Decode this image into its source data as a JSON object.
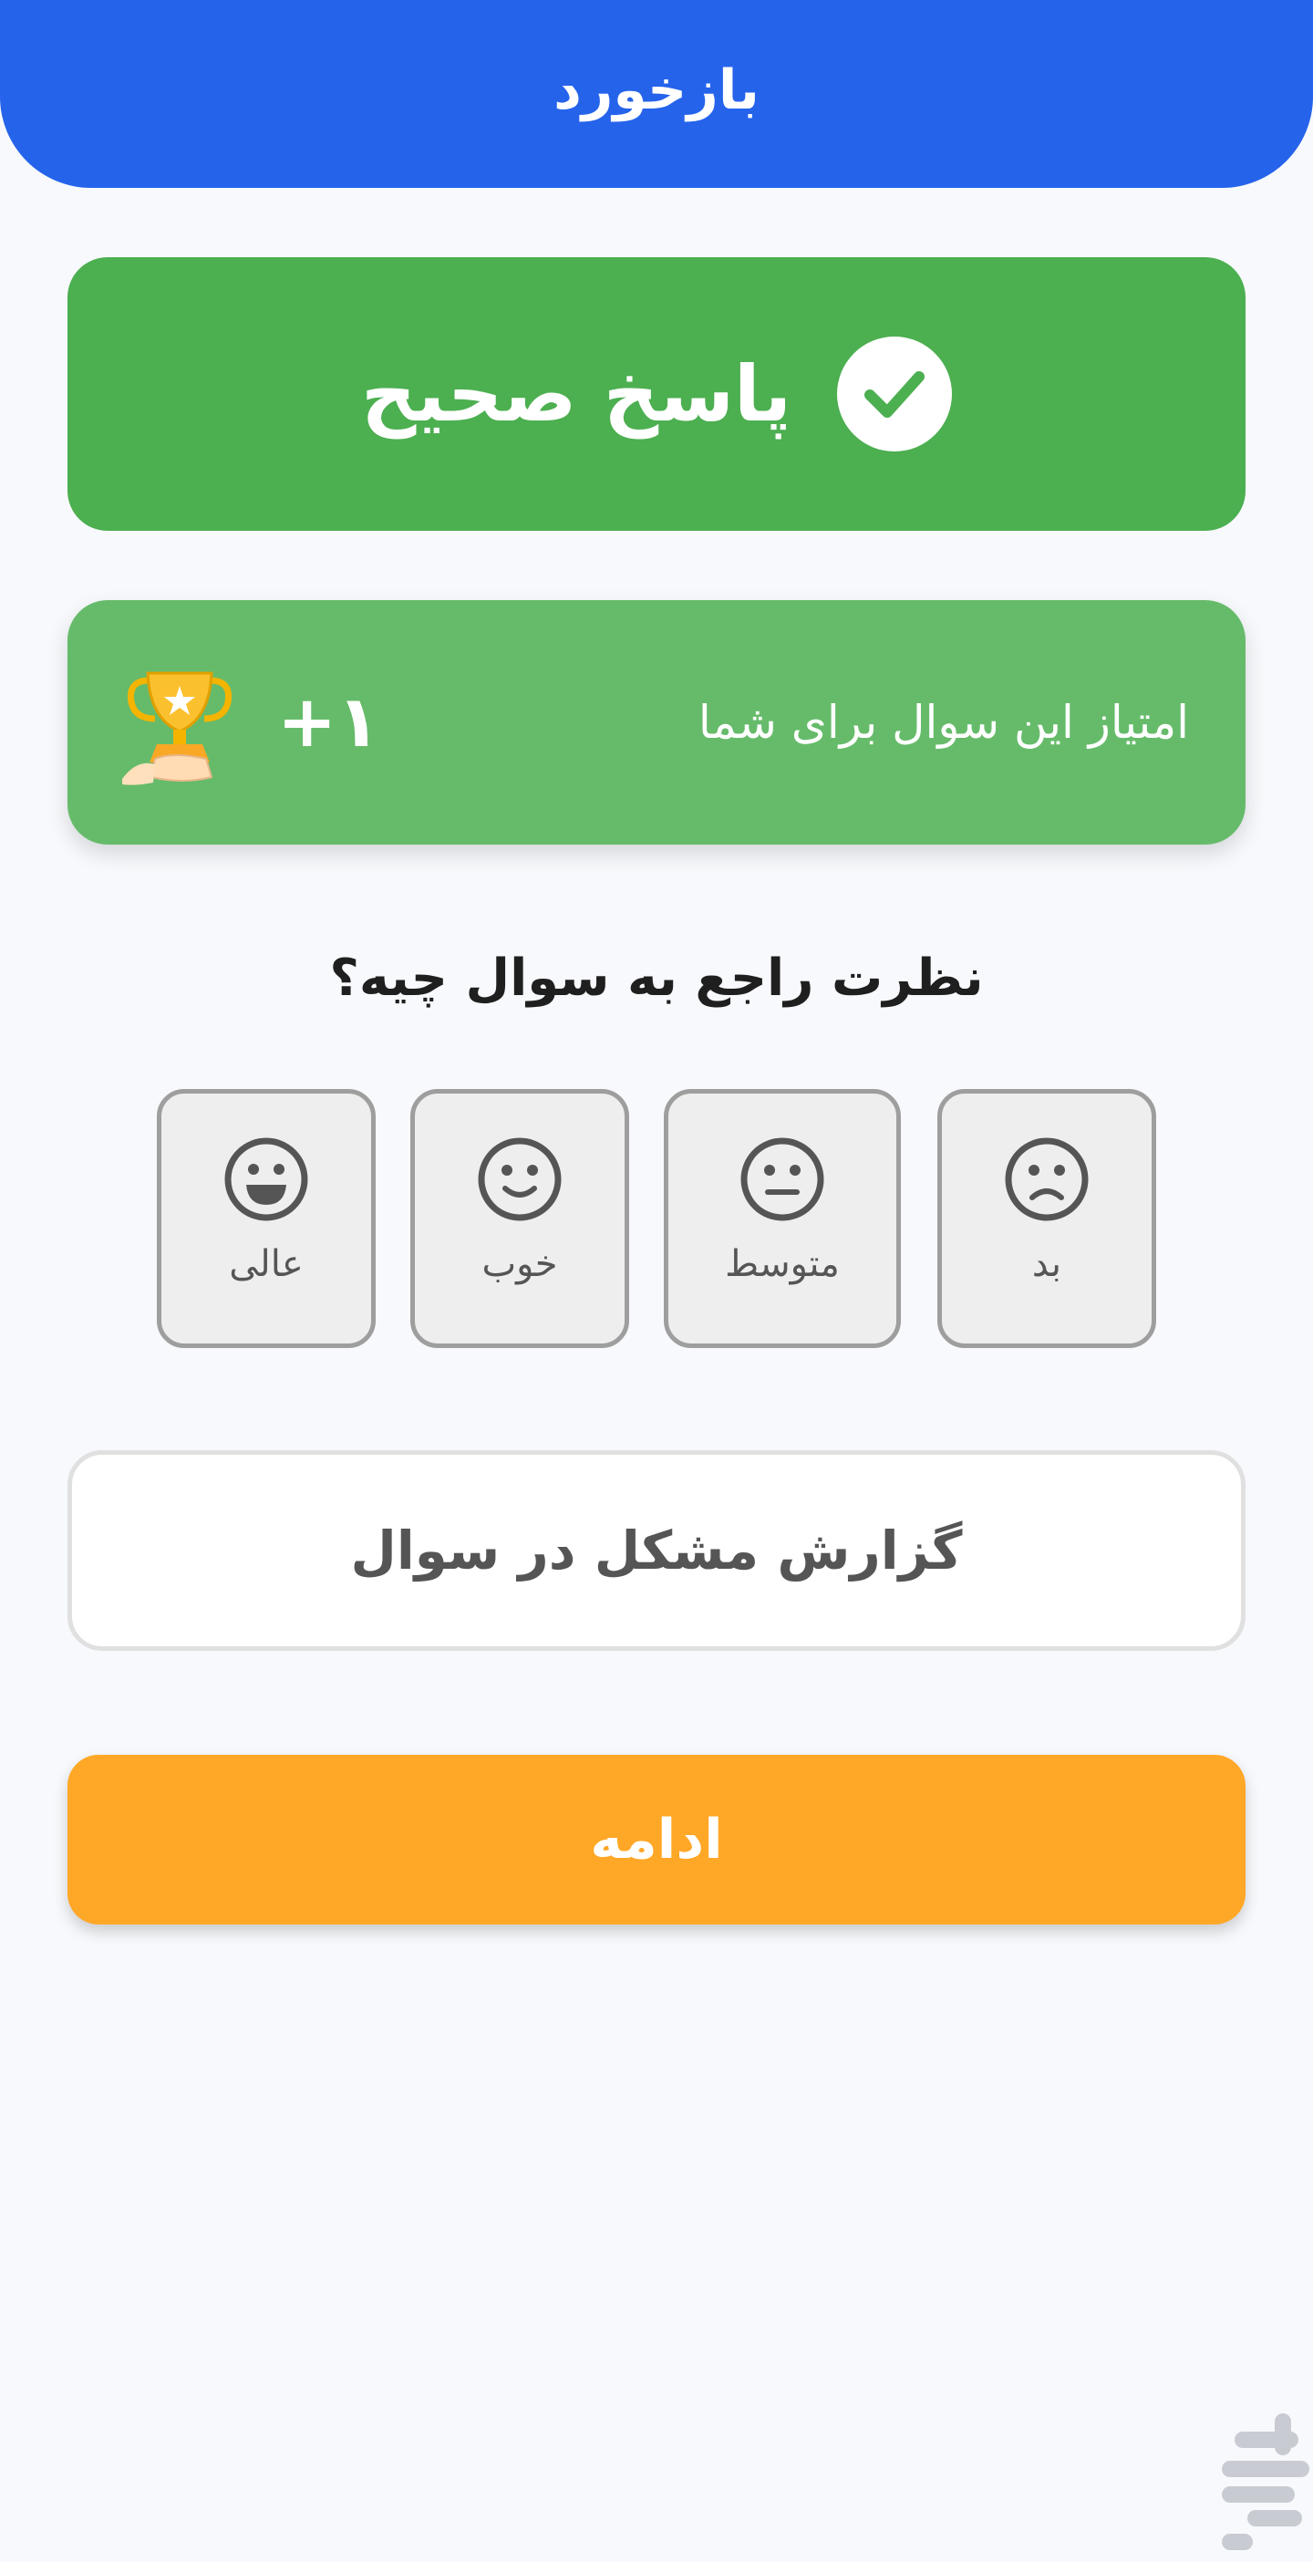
{
  "header": {
    "title": "بازخورد"
  },
  "result": {
    "label": "پاسخ صحیح",
    "icon": "check-circle-icon"
  },
  "score": {
    "label": "امتیاز این سوال برای شما",
    "value": "+۱",
    "icon": "trophy-hand-icon"
  },
  "feedback": {
    "question": "نظرت راجع به سوال چیه؟",
    "options": [
      {
        "label": "بد",
        "icon": "sad-face-icon"
      },
      {
        "label": "متوسط",
        "icon": "neutral-face-icon"
      },
      {
        "label": "خوب",
        "icon": "smile-face-icon"
      },
      {
        "label": "عالی",
        "icon": "grin-face-icon"
      }
    ]
  },
  "actions": {
    "report_label": "گزارش مشکل در سوال",
    "continue_label": "ادامه"
  },
  "colors": {
    "header": "#2563eb",
    "correct": "#4caf50",
    "score": "#66bb6a",
    "continue": "#ffa726"
  }
}
